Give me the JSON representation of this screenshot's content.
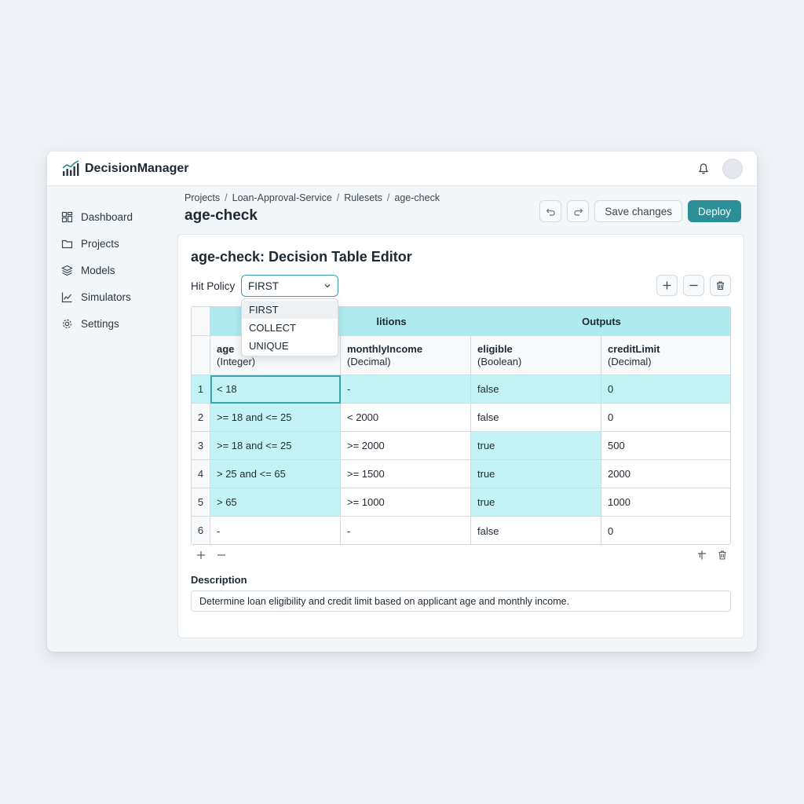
{
  "app": {
    "brand_name": "DecisionManager"
  },
  "sidebar": {
    "items": [
      {
        "label": "Dashboard",
        "icon": "grid-icon"
      },
      {
        "label": "Projects",
        "icon": "folder-icon"
      },
      {
        "label": "Models",
        "icon": "layers-icon"
      },
      {
        "label": "Simulators",
        "icon": "chart-icon"
      },
      {
        "label": "Settings",
        "icon": "gear-icon"
      }
    ]
  },
  "breadcrumb": [
    "Projects",
    "Loan-Approval-Service",
    "Rulesets",
    "age-check"
  ],
  "page_title": "age-check",
  "actions": {
    "save_label": "Save changes",
    "deploy_label": "Deploy"
  },
  "editor": {
    "title": "age-check: Decision Table Editor",
    "hit_policy_label": "Hit Policy",
    "hit_policy_value": "FIRST",
    "hit_policy_options": [
      "FIRST",
      "COLLECT",
      "UNIQUE"
    ],
    "groups": {
      "conditions": "Conditions",
      "conditions_visible": "litions",
      "outputs": "Outputs"
    },
    "columns": [
      {
        "name": "age",
        "type": "(Integer)"
      },
      {
        "name": "monthlyIncome",
        "type": "(Decimal)"
      },
      {
        "name": "eligible",
        "type": "(Boolean)"
      },
      {
        "name": "creditLimit",
        "type": "(Decimal)"
      }
    ],
    "rows": [
      {
        "n": "1",
        "cells": [
          "< 18",
          "-",
          "false",
          "0"
        ]
      },
      {
        "n": "2",
        "cells": [
          ">= 18 and <= 25",
          "< 2000",
          "false",
          "0"
        ]
      },
      {
        "n": "3",
        "cells": [
          ">= 18 and <= 25",
          ">= 2000",
          "true",
          "500"
        ]
      },
      {
        "n": "4",
        "cells": [
          "> 25 and <= 65",
          ">= 1500",
          "true",
          "2000"
        ]
      },
      {
        "n": "5",
        "cells": [
          "> 65",
          ">= 1000",
          "true",
          "1000"
        ]
      },
      {
        "n": "6",
        "cells": [
          "-",
          "-",
          "false",
          "0"
        ]
      }
    ],
    "description_label": "Description",
    "description_value": "Determine loan eligibility and credit limit based on applicant age and monthly income."
  },
  "colors": {
    "accent": "#2c8e96",
    "row_highlight": "#c4f3f6",
    "group_header": "#aeeaee"
  }
}
